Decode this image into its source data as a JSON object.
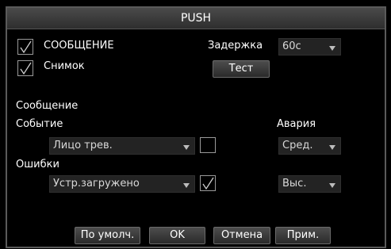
{
  "dialog": {
    "title": "PUSH"
  },
  "top": {
    "message_check": {
      "label": "СООБЩЕНИЕ",
      "checked": true
    },
    "snapshot_check": {
      "label": "Снимок",
      "checked": true
    },
    "delay": {
      "label": "Задержка",
      "value": "60с"
    },
    "test_label": "Тест"
  },
  "section": {
    "message_title": "Сообщение",
    "event_label": "Событие",
    "alarm_label": "Авария",
    "errors_label": "Ошибки"
  },
  "event_row": {
    "dropdown_value": "Лицо трев.",
    "checked": false,
    "level_value": "Сред."
  },
  "errors_row": {
    "dropdown_value": "Устр.загружено",
    "checked": true,
    "level_value": "Выс."
  },
  "buttons": {
    "default_label": "По умолч.",
    "ok_label": "OK",
    "cancel_label": "Отмена",
    "apply_label": "Прим."
  },
  "colors": {
    "background": "#000000",
    "titlebar": "#3a3a3a",
    "dropdown": "#232323",
    "text": "#ffffff"
  }
}
